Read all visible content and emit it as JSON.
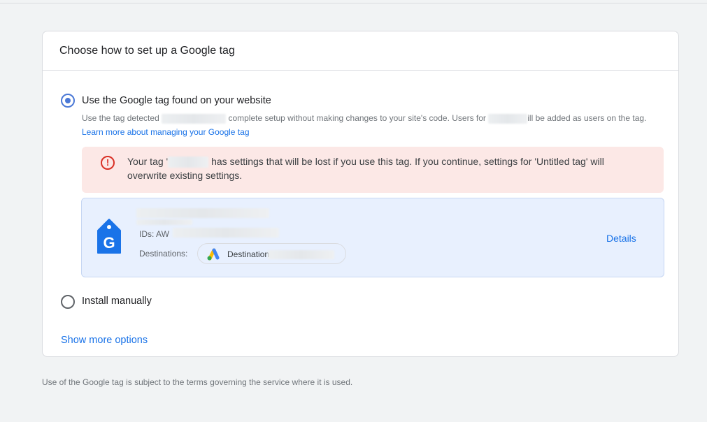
{
  "card": {
    "title": "Choose how to set up a Google tag"
  },
  "option_found": {
    "label": "Use the Google tag found on your website",
    "selected": true,
    "desc_part1": "Use the tag detected",
    "desc_part2": "complete setup without making changes to your site's code. Users for",
    "desc_part3": "ill be added as users on the tag.",
    "learn_more": "Learn more about managing your Google tag"
  },
  "alert": {
    "icon": "error-icon",
    "color": "#d93025",
    "text_part1": "Your tag '",
    "text_part2": "has settings that will be lost if you use this tag. If you continue, settings for 'Untitled tag' will overwrite existing settings."
  },
  "tag": {
    "icon": "google-tag-icon",
    "ids_label": "IDs: AW",
    "destinations_label": "Destinations:",
    "destination_chip": "Destination",
    "details_label": "Details"
  },
  "option_manual": {
    "label": "Install manually",
    "selected": false
  },
  "show_more": "Show more options",
  "footer": "Use of the Google tag is subject to the terms governing the service where it is used.",
  "colors": {
    "accent": "#1a73e8",
    "error": "#d93025",
    "alert_bg": "#fce8e6",
    "tag_bg": "#e8f0fe"
  }
}
